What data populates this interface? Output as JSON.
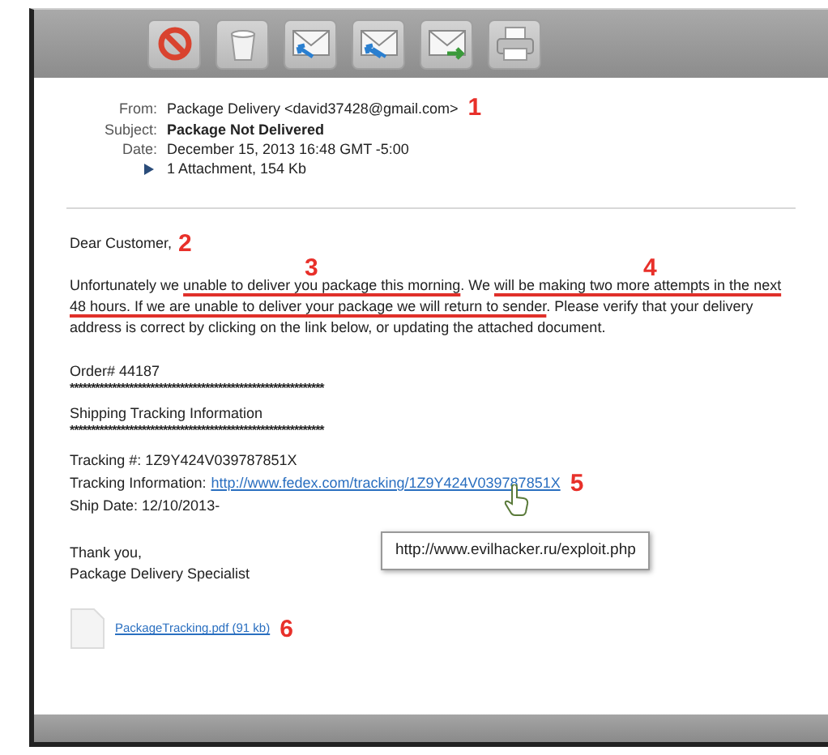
{
  "toolbar": {
    "buttons": [
      {
        "kind": "junk"
      },
      {
        "kind": "delete"
      },
      {
        "kind": "reply"
      },
      {
        "kind": "reply_all"
      },
      {
        "kind": "forward"
      },
      {
        "kind": "print"
      }
    ]
  },
  "header": {
    "fields": [
      {
        "label": "From:",
        "value": "Package Delivery <david37428@gmail.com>",
        "bold": false,
        "annotation": "1"
      },
      {
        "label": "Subject:",
        "value": "Package Not Delivered",
        "bold": true
      },
      {
        "label": "Date:",
        "value": "December 15, 2013 16:48 GMT -5:00",
        "bold": false
      }
    ],
    "attachments": {
      "expanded": false,
      "text": "1 Attachment, 154 Kb"
    }
  },
  "body": {
    "greeting": {
      "text": "Dear Customer,",
      "annotation": "2"
    },
    "paragraph": [
      {
        "text": "Unfortunately we ",
        "underlined": false
      },
      {
        "text": "unable to deliver you package this morning",
        "underlined": true,
        "annotation": "3"
      },
      {
        "text": ". We ",
        "underlined": false
      },
      {
        "text": "will be making two more attempts in the next 48 hours. If we are unable to deliver your package we will return to sender",
        "underlined": true,
        "annotation": "4"
      },
      {
        "text": ". Please verify that your delivery address is correct by clicking on the link below, or updating the  attached document.",
        "underlined": false
      }
    ],
    "order": "Order# 44187",
    "separator_1": "************************************************************",
    "section_title": "Shipping Tracking Information",
    "separator_2": "************************************************************",
    "tracking_number": "Tracking #: 1Z9Y424V039787851X",
    "tracking_label": "Tracking Information:",
    "tracking_link": {
      "text": "http://www.fedex.com/tracking/1Z9Y424V039787851X",
      "annotation": "5",
      "hovered": true
    },
    "ship_date": "Ship Date: 12/10/2013-",
    "tooltip": "http://www.evilhacker.ru/exploit.php",
    "signoff": [
      "Thank you,",
      "Package Delivery Specialist"
    ],
    "attachment": {
      "text": "PackageTracking.pdf (91 kb)",
      "annotation": "6"
    }
  }
}
